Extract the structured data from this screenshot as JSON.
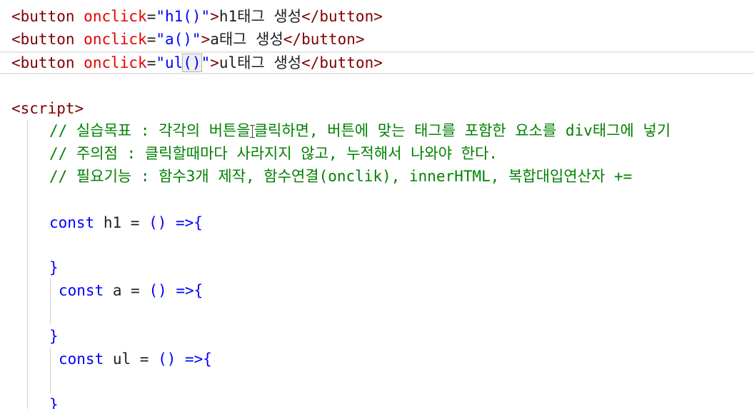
{
  "lines": {
    "l1": {
      "open_tag": "<button",
      "attr": "onclick",
      "eq": "=",
      "value": "\"h1()\"",
      "close": ">",
      "text": "h1태그 생성",
      "end_tag": "</button>"
    },
    "l2": {
      "open_tag": "<button",
      "attr": "onclick",
      "eq": "=",
      "value": "\"a()\"",
      "close": ">",
      "text": "a태그 생성",
      "end_tag": "</button>"
    },
    "l3": {
      "open_tag": "<button",
      "attr": "onclick",
      "eq": "=",
      "value_pre": "\"ul",
      "value_paren": "()",
      "value_post": "\"",
      "close": ">",
      "text": "ul태그 생성",
      "end_tag": "</button>"
    },
    "script_open": "<script>",
    "comment1_pre": "// 실습목표 : 각각의 버튼을",
    "comment1_post": "클릭하면, 버튼에 맞는 태그를 포함한 요소를 div태그에 넣기",
    "comment2": "// 주의점 : 클릭할때마다 사라지지 않고, 누적해서 나와야 한다.",
    "comment3": "// 필요기능 : 함수3개 제작, 함수연결(onclik), innerHTML, 복합대입연산자 +=",
    "h1_const": "const",
    "h1_name": " h1 = ",
    "h1_arrow": "() =>{",
    "brace1": "}",
    "a_const": "const",
    "a_name": " a = ",
    "a_arrow": "() =>{",
    "brace2": "}",
    "ul_const": "const",
    "ul_name": " ul = ",
    "ul_arrow": "() =>{",
    "brace3": "}"
  }
}
